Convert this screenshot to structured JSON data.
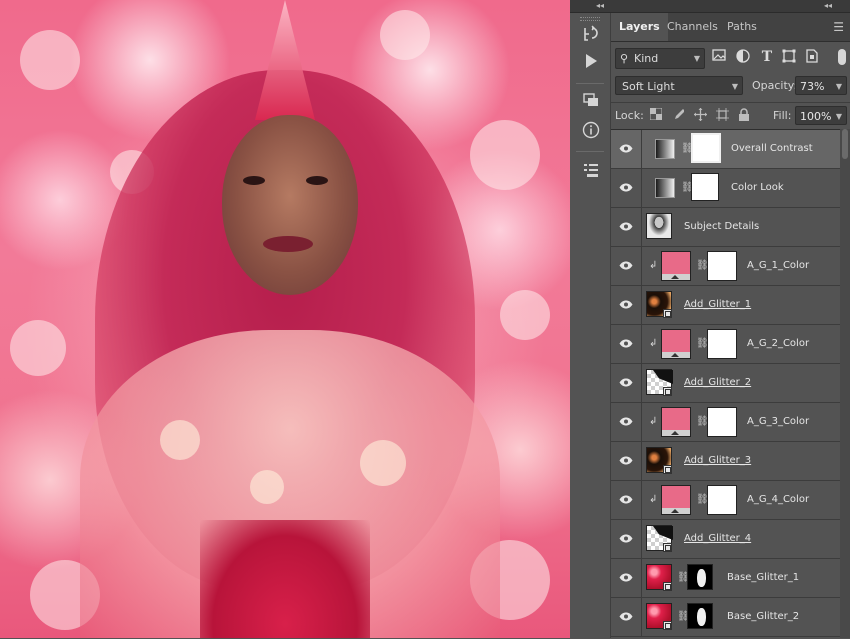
{
  "canvas": {
    "description_colors": {
      "primary": "#f06a8c",
      "hair": "#c42b58",
      "dress": "#d8204a"
    }
  },
  "panel": {
    "tabs": [
      {
        "label": "Layers",
        "active": true
      },
      {
        "label": "Channels",
        "active": false
      },
      {
        "label": "Paths",
        "active": false
      }
    ],
    "filter": {
      "kind_label": "Kind"
    },
    "blend_mode": "Soft Light",
    "opacity_label": "Opacity:",
    "opacity_value": "73%",
    "lock_label": "Lock:",
    "fill_label": "Fill:",
    "fill_value": "100%",
    "layers": [
      {
        "name": "Overall Contrast",
        "selected": true
      },
      {
        "name": "Color Look",
        "selected": false
      },
      {
        "name": "Subject Details",
        "selected": false
      },
      {
        "name": "A_G_1_Color",
        "selected": false
      },
      {
        "name": "Add_Glitter_1",
        "selected": false
      },
      {
        "name": "A_G_2_Color",
        "selected": false
      },
      {
        "name": "Add_Glitter_2",
        "selected": false
      },
      {
        "name": "A_G_3_Color",
        "selected": false
      },
      {
        "name": "Add_Glitter_3",
        "selected": false
      },
      {
        "name": "A_G_4_Color",
        "selected": false
      },
      {
        "name": "Add_Glitter_4",
        "selected": false
      },
      {
        "name": "Base_Glitter_1",
        "selected": false
      },
      {
        "name": "Base_Glitter_2",
        "selected": false
      }
    ]
  },
  "colors": {
    "panel_bg": "#535353",
    "selected_row": "#666666",
    "tab_bar": "#424242"
  }
}
